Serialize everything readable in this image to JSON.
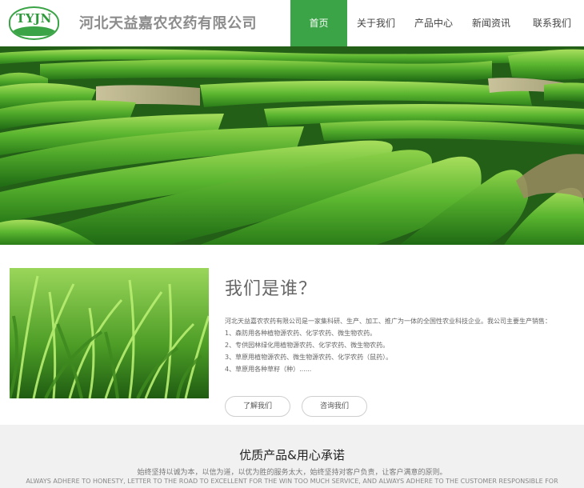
{
  "header": {
    "logo_text": "TYJN",
    "company_name": "河北天益嘉农农药有限公司",
    "nav": [
      {
        "label": "首页",
        "active": true
      },
      {
        "label": "关于我们",
        "active": false
      },
      {
        "label": "产品中心",
        "active": false
      },
      {
        "label": "新闻资讯",
        "active": false
      },
      {
        "label": "联系我们",
        "active": false
      }
    ]
  },
  "banner": {
    "image_icon": "tea-plantation-image"
  },
  "about": {
    "image_icon": "grass-image",
    "title": "我们是谁？",
    "intro": "河北天益嘉农农药有限公司是一家集科研、生产、加工、推广为一体的全国性农业科技企业。我公司主要生产销售：",
    "items": [
      "1、森防用各种植物源农药、化学农药、微生物农药。",
      "2、专供园林绿化用植物源农药、化学农药、微生物农药。",
      "3、草原用植物源农药、微生物源农药、化学农药（鼠药）。",
      "4、草原用各种草籽（种）......"
    ],
    "button_about": "了解我们",
    "button_consult": "咨询我们"
  },
  "promise": {
    "title": "优质产品&用心承诺",
    "text_cn": "始终坚持以诚为本，以信为道，以优为胜的服务太大，始终坚持对客户负责，让客户满意的原则。",
    "text_en": "ALWAYS ADHERE TO HONESTY, LETTER TO THE ROAD TO EXCELLENT FOR THE WIN TOO MUCH SERVICE, AND ALWAYS ADHERE TO THE CUSTOMER RESPONSIBLE FOR"
  },
  "colors": {
    "brand_green": "#3aa446",
    "footer_bg": "#f1f1f1"
  }
}
